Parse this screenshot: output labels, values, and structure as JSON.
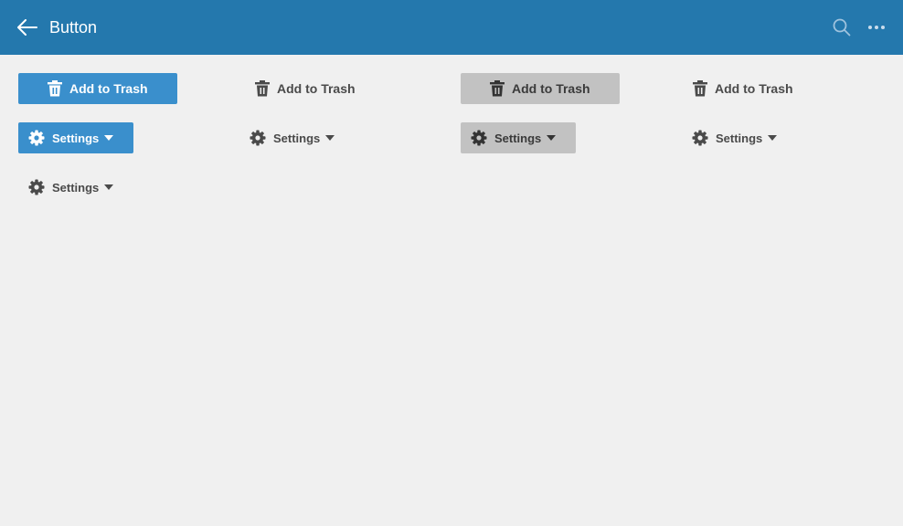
{
  "header": {
    "title": "Button",
    "back_icon": "arrow-left-icon",
    "search_icon": "search-icon",
    "more_icon": "more-horizontal-icon",
    "background": "#2478ad"
  },
  "buttons": {
    "trash_label": "Add to Trash",
    "settings_label": "Settings",
    "trash_icon": "trash-icon",
    "settings_icon": "gear-icon",
    "caret_icon": "caret-down-icon"
  },
  "colors": {
    "primary": "#3a8fcc",
    "grey": "#c2c2c2",
    "flat_text": "#4a4a4a",
    "background": "#f0f0f0"
  }
}
